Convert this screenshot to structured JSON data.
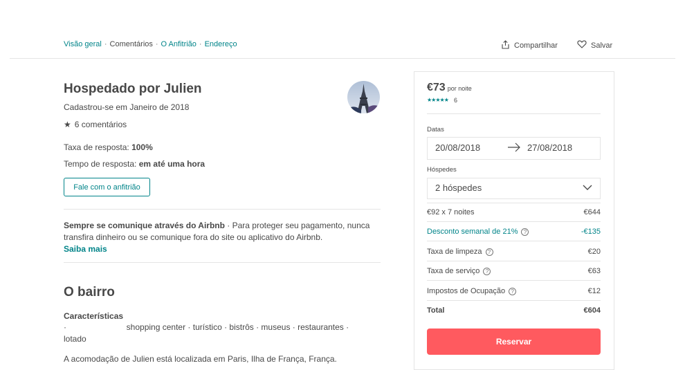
{
  "nav": {
    "items": [
      "Visão geral",
      "Comentários",
      "O Anfitrião",
      "Endereço"
    ],
    "separator": "·"
  },
  "actions": {
    "share": "Compartilhar",
    "save": "Salvar"
  },
  "host": {
    "title": "Hospedado por Julien",
    "joined": "Cadastrou-se em Janeiro de 2018",
    "star": "★",
    "reviews": "6 comentários",
    "response_rate_label": "Taxa de resposta: ",
    "response_rate_value": "100%",
    "response_time_label": "Tempo de resposta: ",
    "response_time_value": "em até uma hora",
    "contact_button": "Fale com o anfitrião",
    "avatar_icon": "eiffel-tower-photo"
  },
  "notice": {
    "bold": "Sempre se comunique através do Airbnb",
    "text": " · Para proteger seu pagamento, nunca transfira dinheiro ou se comunique fora do site ou aplicativo do Airbnb.",
    "link": "Saiba mais"
  },
  "neighborhood": {
    "title": "O bairro",
    "features_title": "Características",
    "features_text": "·                          shopping center · turístico · bistrôs · museus · restaurantes · lotado",
    "cut_text": "A acomodação de Julien está localizada em Paris, Ilha de França, França."
  },
  "booking": {
    "price": "€73",
    "per_night": "por noite",
    "stars": "★★★★★",
    "rating_count": "6",
    "dates_label": "Datas",
    "checkin": "20/08/2018",
    "checkout": "27/08/2018",
    "guests_label": "Hóspedes",
    "guests_value": "2 hóspedes",
    "rows": [
      {
        "label": "€92 x 7 noites",
        "value": "€644"
      },
      {
        "label": "Desconto semanal de 21%",
        "value": "-€135"
      },
      {
        "label": "Taxa de limpeza",
        "value": "€20"
      },
      {
        "label": "Taxa de serviço",
        "value": "€63"
      },
      {
        "label": "Impostos de Ocupação",
        "value": "€12"
      },
      {
        "label": "Total",
        "value": "€604"
      }
    ],
    "help_glyph": "?",
    "reserve": "Reservar"
  },
  "colors": {
    "teal": "#008489",
    "reserve": "#ff5a5f",
    "text": "#484848",
    "border": "#e4e4e4"
  }
}
